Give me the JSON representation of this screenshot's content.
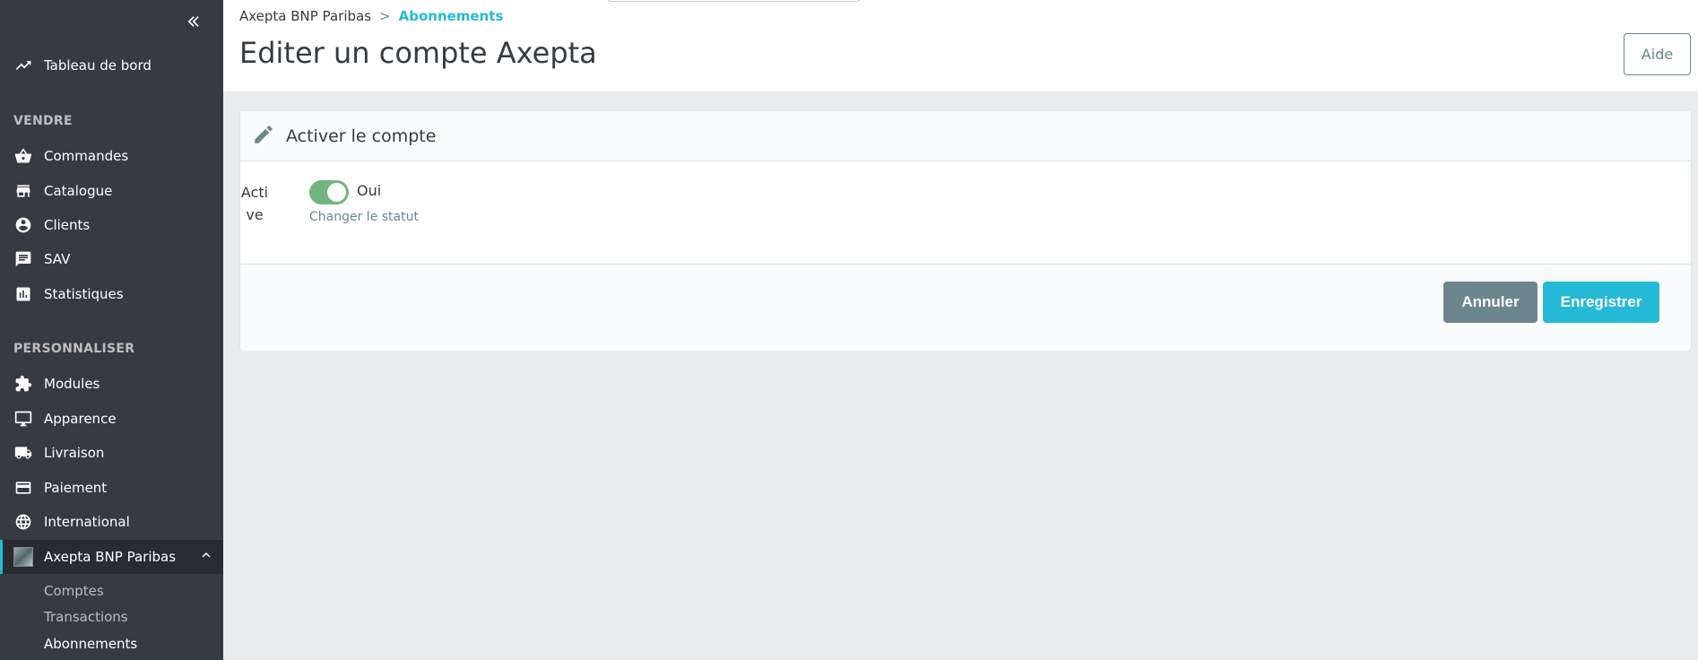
{
  "sidebar": {
    "collapse_icon": "double-chevron-left-icon",
    "dashboard": {
      "label": "Tableau de bord",
      "icon": "trending-up-icon"
    },
    "section_sell": "VENDRE",
    "sell_items": [
      {
        "label": "Commandes",
        "icon": "shopping-basket-icon"
      },
      {
        "label": "Catalogue",
        "icon": "store-icon"
      },
      {
        "label": "Clients",
        "icon": "account-circle-icon"
      },
      {
        "label": "SAV",
        "icon": "chat-icon"
      },
      {
        "label": "Statistiques",
        "icon": "bar-chart-icon"
      }
    ],
    "section_customize": "PERSONNALISER",
    "customize_items": [
      {
        "label": "Modules",
        "icon": "puzzle-icon"
      },
      {
        "label": "Apparence",
        "icon": "desktop-icon"
      },
      {
        "label": "Livraison",
        "icon": "truck-icon"
      },
      {
        "label": "Paiement",
        "icon": "credit-card-icon"
      },
      {
        "label": "International",
        "icon": "globe-icon"
      }
    ],
    "active_module": {
      "label": "Axepta BNP Paribas",
      "icon": "module-logo"
    },
    "sub_items": [
      {
        "label": "Comptes"
      },
      {
        "label": "Transactions"
      },
      {
        "label": "Abonnements"
      }
    ]
  },
  "header": {
    "breadcrumb": {
      "parent": "Axepta BNP Paribas",
      "separator": ">",
      "current": "Abonnements"
    },
    "title": "Editer un compte Axepta",
    "help_label": "Aide"
  },
  "card": {
    "title": "Activer le compte",
    "icon": "pencil-icon",
    "field_label_1": "Acti",
    "field_label_2": "ve",
    "switch_value": "Oui",
    "switch_on": true,
    "help_text": "Changer le statut",
    "cancel_label": "Annuler",
    "save_label": "Enregistrer"
  },
  "colors": {
    "sidebar_bg": "#363a41",
    "accent": "#25b9d7",
    "switch_on": "#70b580",
    "secondary": "#6c868e"
  }
}
